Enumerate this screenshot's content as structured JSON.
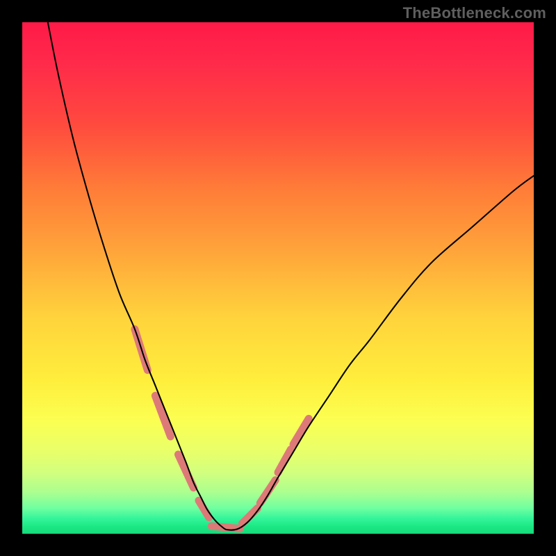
{
  "watermark": "TheBottleneck.com",
  "chart_data": {
    "type": "line",
    "title": "",
    "xlabel": "",
    "ylabel": "",
    "xlim": [
      0,
      100
    ],
    "ylim": [
      0,
      100
    ],
    "grid": false,
    "series": [
      {
        "name": "curve",
        "color": "#000000",
        "x": [
          5,
          7,
          10,
          13,
          16,
          19,
          22,
          24,
          26,
          28,
          30,
          32,
          33.5,
          35,
          36,
          37,
          38,
          39,
          40,
          42,
          44,
          46,
          48,
          50,
          53,
          56,
          60,
          64,
          68,
          74,
          80,
          88,
          96,
          100
        ],
        "y": [
          100,
          90,
          77,
          66,
          56,
          47,
          40,
          34,
          29,
          24,
          19,
          14,
          10,
          7,
          5,
          3.5,
          2.3,
          1.4,
          0.8,
          0.9,
          2.2,
          4.5,
          7.5,
          11,
          16,
          21,
          27,
          33,
          38,
          46,
          53,
          60,
          67,
          70
        ]
      }
    ],
    "overlay_segments": {
      "color": "#dd7a78",
      "width": 11,
      "segments": [
        {
          "p1": [
            22.0,
            40.0
          ],
          "p2": [
            24.5,
            32.0
          ]
        },
        {
          "p1": [
            26.0,
            27.0
          ],
          "p2": [
            29.0,
            19.0
          ]
        },
        {
          "p1": [
            30.5,
            15.5
          ],
          "p2": [
            33.5,
            9.0
          ]
        },
        {
          "p1": [
            34.5,
            6.5
          ],
          "p2": [
            36.5,
            3.2
          ]
        },
        {
          "p1": [
            37.0,
            1.5
          ],
          "p2": [
            42.5,
            1.0
          ]
        },
        {
          "p1": [
            43.0,
            2.0
          ],
          "p2": [
            46.0,
            5.0
          ]
        },
        {
          "p1": [
            46.5,
            6.0
          ],
          "p2": [
            49.5,
            10.5
          ]
        },
        {
          "p1": [
            50.0,
            12.0
          ],
          "p2": [
            52.5,
            16.5
          ]
        },
        {
          "p1": [
            53.0,
            17.5
          ],
          "p2": [
            56.0,
            22.5
          ]
        }
      ]
    },
    "gradient_stops": [
      {
        "pos": 0,
        "color": "#ff1a48"
      },
      {
        "pos": 50,
        "color": "#ffc83c"
      },
      {
        "pos": 78,
        "color": "#fbff52"
      },
      {
        "pos": 100,
        "color": "#14da7a"
      }
    ]
  }
}
